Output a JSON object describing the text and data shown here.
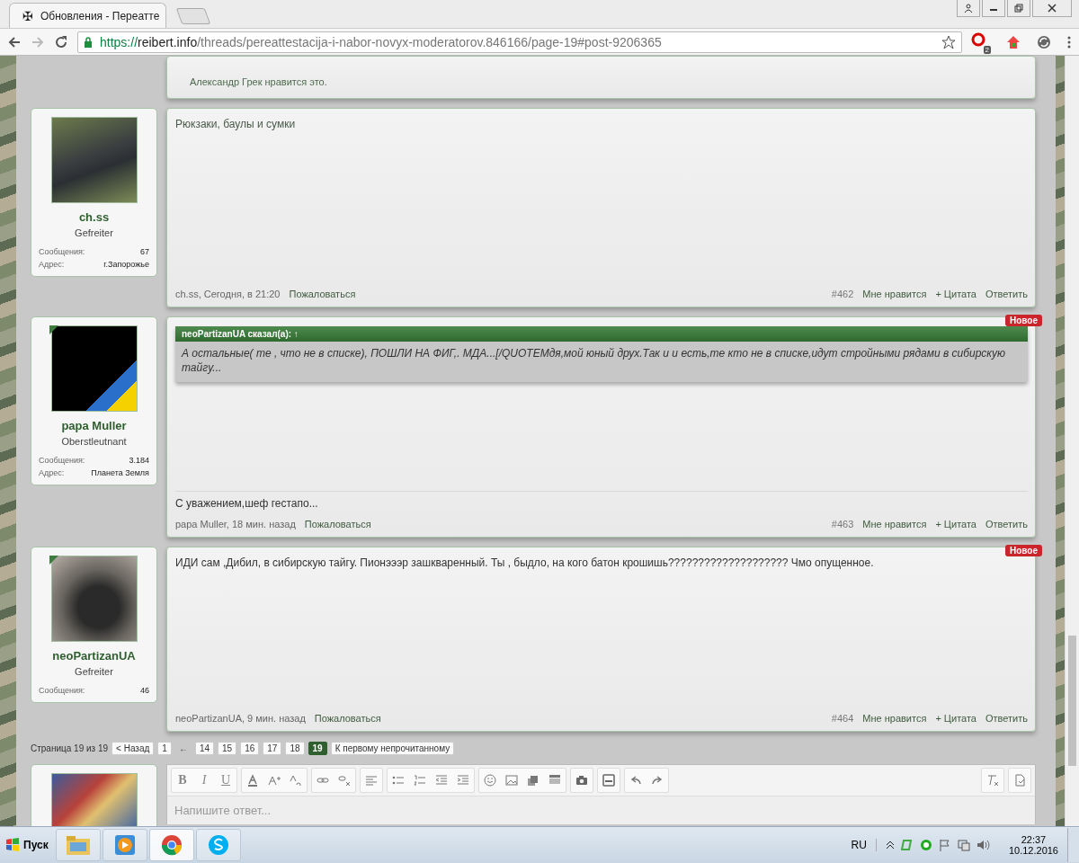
{
  "browser": {
    "tab_icon": "✠",
    "tab_title": "Обновления - Переатте",
    "url_scheme": "https://",
    "url_host": "reibert.info",
    "url_path": "/threads/pereattestacija-i-nabor-novyx-moderatorov.846166/page-19#post-9206365",
    "extension_badge": "2"
  },
  "top_post": {
    "likes": "Александр Грек нравится это."
  },
  "posts": [
    {
      "author": "ch.ss",
      "rank": "Gefreiter",
      "is_new": false,
      "stats": [
        {
          "label": "Сообщения:",
          "value": "67"
        },
        {
          "label": "Адрес:",
          "value": "г.Запорожье"
        }
      ],
      "body": "Рюкзаки, баулы и сумки",
      "author_time": "ch.ss, Сегодня, в 21:20",
      "report": "Пожаловаться",
      "number": "#462",
      "like": "Мне нравится",
      "quote_btn": "+ Цитата",
      "reply": "Ответить"
    },
    {
      "author": "papa Muller",
      "rank": "Oberstleutnant",
      "is_new": true,
      "new_label": "Новое",
      "stats": [
        {
          "label": "Сообщения:",
          "value": "3.184"
        },
        {
          "label": "Адрес:",
          "value": "Планета Земля"
        }
      ],
      "quote": {
        "title": "neoPartizanUA сказал(а): ↑",
        "text": "А остальные( те , что не в списке), ПОШЛИ НА ФИГ,. МДА...[/QUOTEМдя,мой юный друх.Так и и есть,те кто не в списке,идут стройными рядами в сибирскую тайгу..."
      },
      "signature": "С уважением,шеф гестапо...",
      "author_time": "papa Muller, 18 мин. назад",
      "report": "Пожаловаться",
      "number": "#463",
      "like": "Мне нравится",
      "quote_btn": "+ Цитата",
      "reply": "Ответить"
    },
    {
      "author": "neoPartizanUA",
      "rank": "Gefreiter",
      "is_new": true,
      "new_label": "Новое",
      "stats": [
        {
          "label": "Сообщения:",
          "value": "46"
        }
      ],
      "body": "ИДИ сам ,Дибил, в сибирскую тайгу. Пионэээр зашкваренный. Ты , быдло, на кого батон крошишь???????????????????? Чмо опущенное.",
      "author_time": "neoPartizanUA, 9 мин. назад",
      "report": "Пожаловаться",
      "number": "#464",
      "like": "Мне нравится",
      "quote_btn": "+ Цитата",
      "reply": "Ответить"
    }
  ],
  "pagination": {
    "summary": "Страница 19 из 19",
    "prev": "< Назад",
    "pages": [
      {
        "label": "1",
        "selected": false
      },
      {
        "label": "←",
        "kind": "gap"
      },
      {
        "label": "14",
        "selected": false
      },
      {
        "label": "15",
        "selected": false
      },
      {
        "label": "16",
        "selected": false
      },
      {
        "label": "17",
        "selected": false
      },
      {
        "label": "18",
        "selected": false
      },
      {
        "label": "19",
        "selected": true
      }
    ],
    "first_unread": "К первому непрочитанному"
  },
  "editor": {
    "format_buttons": [
      "B",
      "I",
      "U"
    ],
    "placeholder": "Напишите ответ..."
  },
  "taskbar": {
    "start": "Пуск",
    "language": "RU",
    "time": "22:37",
    "date": "10.12.2016"
  }
}
